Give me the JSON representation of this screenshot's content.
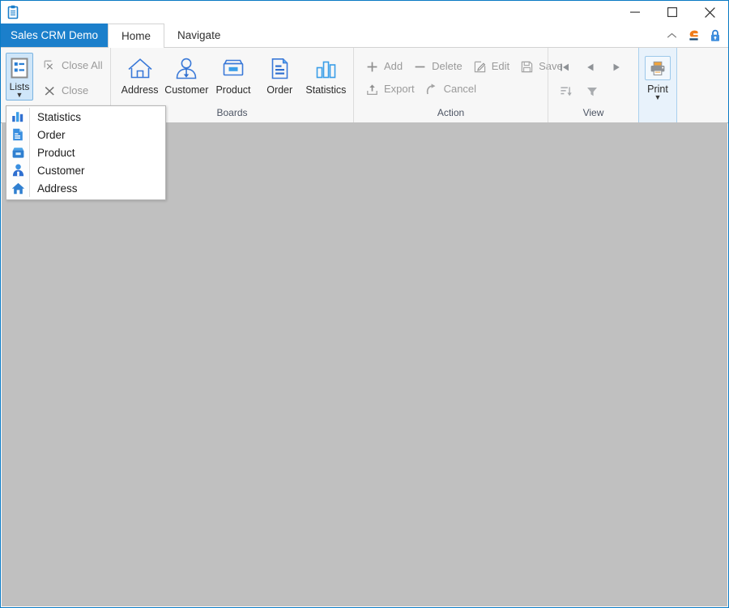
{
  "window": {
    "app_icon": "clipboard-icon",
    "controls": {
      "minimize": "minimize-icon",
      "maximize": "maximize-icon",
      "close": "close-icon"
    }
  },
  "tab_strip": {
    "app_menu_label": "Sales CRM Demo",
    "tabs": [
      {
        "label": "Home",
        "active": true
      },
      {
        "label": "Navigate",
        "active": false
      }
    ],
    "right_icons": [
      {
        "name": "collapse-ribbon-icon"
      },
      {
        "name": "brand-logo-icon"
      },
      {
        "name": "lock-icon"
      }
    ]
  },
  "ribbon": {
    "groups": [
      {
        "label": "",
        "lists_button": {
          "label": "Lists",
          "icon": "list-icon",
          "active": true,
          "has_caret": true
        },
        "close_all": {
          "label": "Close All",
          "icon": "close-all-icon",
          "enabled": false
        },
        "close": {
          "label": "Close",
          "icon": "close-x-icon",
          "enabled": false
        }
      },
      {
        "label": "Boards",
        "items": [
          {
            "label": "Address",
            "icon": "home-icon"
          },
          {
            "label": "Customer",
            "icon": "person-icon"
          },
          {
            "label": "Product",
            "icon": "box-icon"
          },
          {
            "label": "Order",
            "icon": "document-icon"
          },
          {
            "label": "Statistics",
            "icon": "bar-chart-icon"
          }
        ]
      },
      {
        "label": "Action",
        "row1": [
          {
            "label": "Add",
            "icon": "plus-icon",
            "enabled": false
          },
          {
            "label": "Delete",
            "icon": "minus-icon",
            "enabled": false
          },
          {
            "label": "Edit",
            "icon": "pencil-square-icon",
            "enabled": false
          },
          {
            "label": "Save",
            "icon": "floppy-disk-icon",
            "enabled": false
          }
        ],
        "row2": [
          {
            "label": "Export",
            "icon": "upload-icon",
            "enabled": false
          },
          {
            "label": "Cancel",
            "icon": "undo-arrow-icon",
            "enabled": false
          }
        ]
      },
      {
        "label": "View",
        "row1": [
          {
            "name": "first-record-icon"
          },
          {
            "name": "previous-record-icon"
          },
          {
            "name": "next-record-icon"
          },
          {
            "name": "last-record-icon"
          }
        ],
        "row2": [
          {
            "name": "sort-icon"
          },
          {
            "name": "filter-icon"
          }
        ]
      },
      {
        "label": "",
        "print_button": {
          "label": "Print",
          "icon": "printer-icon",
          "has_caret": true
        }
      }
    ]
  },
  "lists_menu": {
    "items": [
      {
        "label": "Statistics",
        "icon": "bar-chart-filled-icon"
      },
      {
        "label": "Order",
        "icon": "document-filled-icon"
      },
      {
        "label": "Product",
        "icon": "box-filled-icon"
      },
      {
        "label": "Customer",
        "icon": "person-filled-icon"
      },
      {
        "label": "Address",
        "icon": "home-filled-icon"
      }
    ]
  },
  "colors": {
    "accent_blue": "#1b7fcb",
    "icon_blue": "#2b7fd4",
    "workspace_gray": "#c0c0c0",
    "ribbon_bg": "#f7f7f7",
    "disabled_gray": "#9a9a9a",
    "highlight_blue": "#cfe6f9",
    "logo_orange": "#f07d1a"
  }
}
